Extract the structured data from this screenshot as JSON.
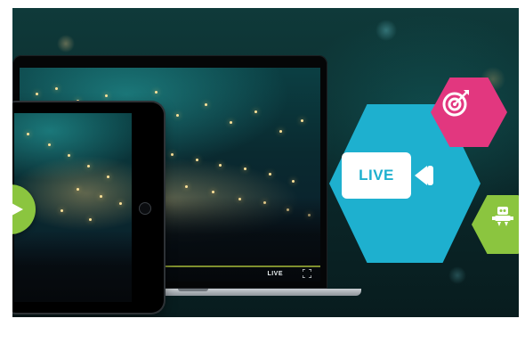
{
  "player": {
    "live_label": "LIVE"
  },
  "promo": {
    "live_badge_label": "LIVE"
  },
  "icons": {
    "play": "play-icon",
    "fullscreen": "fullscreen-icon",
    "camera": "video-camera-icon",
    "target": "target-icon",
    "robot": "robot-icon"
  },
  "colors": {
    "cyan": "#1eb0cf",
    "magenta": "#e2377f",
    "green": "#8bc53f",
    "progress": "#7f8f2e"
  }
}
